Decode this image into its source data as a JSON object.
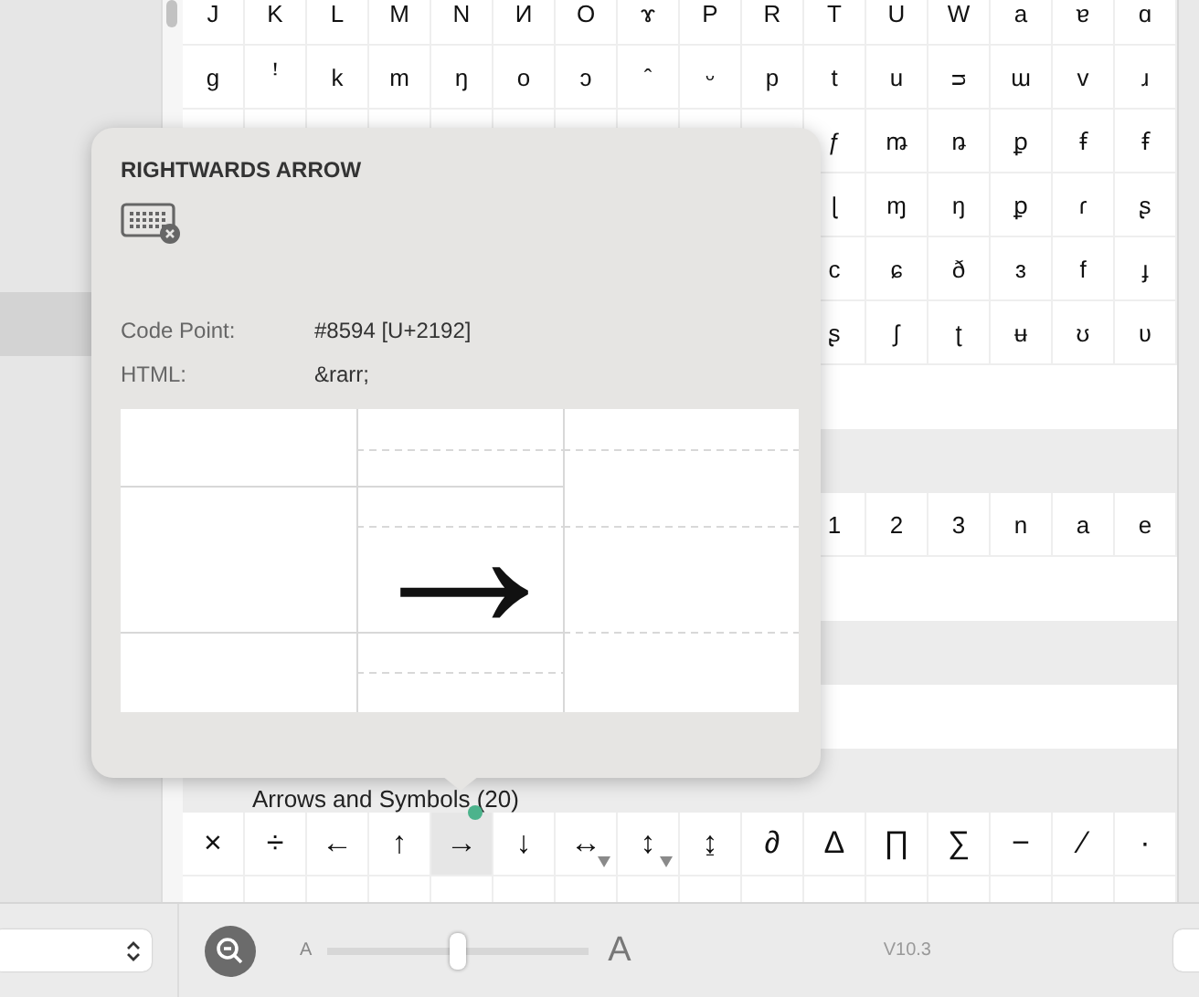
{
  "sidebar": {
    "items": [
      {
        "selected": true
      }
    ]
  },
  "grid": {
    "blocks": [
      {
        "kind": "row",
        "cells": [
          {
            "char": "J"
          },
          {
            "char": "K"
          },
          {
            "char": "L"
          },
          {
            "char": "M"
          },
          {
            "char": "N"
          },
          {
            "char": "И"
          },
          {
            "char": "O"
          },
          {
            "char": "ɤ"
          },
          {
            "char": "P"
          },
          {
            "char": "R"
          },
          {
            "char": "T"
          },
          {
            "char": "U"
          },
          {
            "char": "W"
          },
          {
            "char": "a"
          },
          {
            "char": "ɐ"
          },
          {
            "char": "ɑ"
          }
        ]
      },
      {
        "kind": "row",
        "cells": [
          {
            "char": "g"
          },
          {
            "char": "ꜝ"
          },
          {
            "char": "k"
          },
          {
            "char": "m"
          },
          {
            "char": "ŋ"
          },
          {
            "char": "o"
          },
          {
            "char": "ɔ"
          },
          {
            "char": "ˆ"
          },
          {
            "char": "ᵕ"
          },
          {
            "char": "p"
          },
          {
            "char": "t"
          },
          {
            "char": "u"
          },
          {
            "char": "ᴝ"
          },
          {
            "char": "ɯ"
          },
          {
            "char": "v"
          },
          {
            "char": "ɹ"
          }
        ]
      },
      {
        "kind": "row",
        "cells": [
          {
            "char": "ƒ"
          },
          {
            "char": "ꬺ"
          },
          {
            "char": "ꬻ"
          },
          {
            "char": "ꝑ"
          },
          {
            "char": "ꞙ"
          },
          {
            "char": "ꞙ"
          }
        ]
      },
      {
        "kind": "row",
        "cells": [
          {
            "char": "ɭ"
          },
          {
            "char": "ɱ"
          },
          {
            "char": "ŋ"
          },
          {
            "char": "ꝑ"
          },
          {
            "char": "ɾ"
          },
          {
            "char": "ʂ"
          }
        ]
      },
      {
        "kind": "row",
        "cells": [
          {
            "char": "c"
          },
          {
            "char": "ɕ"
          },
          {
            "char": "ð"
          },
          {
            "char": "ɜ"
          },
          {
            "char": "f"
          },
          {
            "char": "ɟ"
          }
        ]
      },
      {
        "kind": "row",
        "cells": [
          {
            "char": "ʂ"
          },
          {
            "char": "ʃ"
          },
          {
            "char": "ʈ"
          },
          {
            "char": "ʉ"
          },
          {
            "char": "ʊ"
          },
          {
            "char": "ʋ"
          }
        ]
      },
      {
        "kind": "blank"
      },
      {
        "kind": "header"
      },
      {
        "kind": "row",
        "cells": [
          {
            "char": "1"
          },
          {
            "char": "2"
          },
          {
            "char": "3"
          },
          {
            "char": "n"
          },
          {
            "char": "a"
          },
          {
            "char": "e"
          }
        ]
      },
      {
        "kind": "blank"
      },
      {
        "kind": "header"
      },
      {
        "kind": "blank"
      },
      {
        "kind": "header",
        "label": "Arrows and Symbols (20)"
      },
      {
        "kind": "row",
        "cells": [
          {
            "char": "×",
            "selected": false,
            "variants": false
          },
          {
            "char": "÷",
            "selected": false,
            "variants": false
          },
          {
            "char": "←",
            "selected": false,
            "variants": false
          },
          {
            "char": "↑",
            "selected": false,
            "variants": false
          },
          {
            "char": "→",
            "selected": true,
            "variants": false
          },
          {
            "char": "↓",
            "selected": false,
            "variants": false
          },
          {
            "char": "↔",
            "selected": false,
            "variants": true
          },
          {
            "char": "↕",
            "selected": false,
            "variants": true
          },
          {
            "char": "↨",
            "selected": false,
            "variants": false
          },
          {
            "char": "∂",
            "selected": false,
            "variants": false
          },
          {
            "char": "∆",
            "selected": false,
            "variants": false
          },
          {
            "char": "∏",
            "selected": false,
            "variants": false
          },
          {
            "char": "∑",
            "selected": false,
            "variants": false
          },
          {
            "char": "−",
            "selected": false,
            "variants": false
          },
          {
            "char": "∕",
            "selected": false,
            "variants": false
          },
          {
            "char": "·",
            "selected": false,
            "variants": false
          }
        ]
      }
    ]
  },
  "popover": {
    "title": "RIGHTWARDS ARROW",
    "fields": [
      {
        "label": "Code Point:",
        "value": "#8594 [U+2192]"
      },
      {
        "label": "HTML:",
        "value": "&rarr;"
      }
    ],
    "preview": "→"
  },
  "bottom_bar": {
    "size_slider": {
      "min_label": "A",
      "max_label": "A",
      "level": 0.5
    },
    "version": "V10.3"
  }
}
